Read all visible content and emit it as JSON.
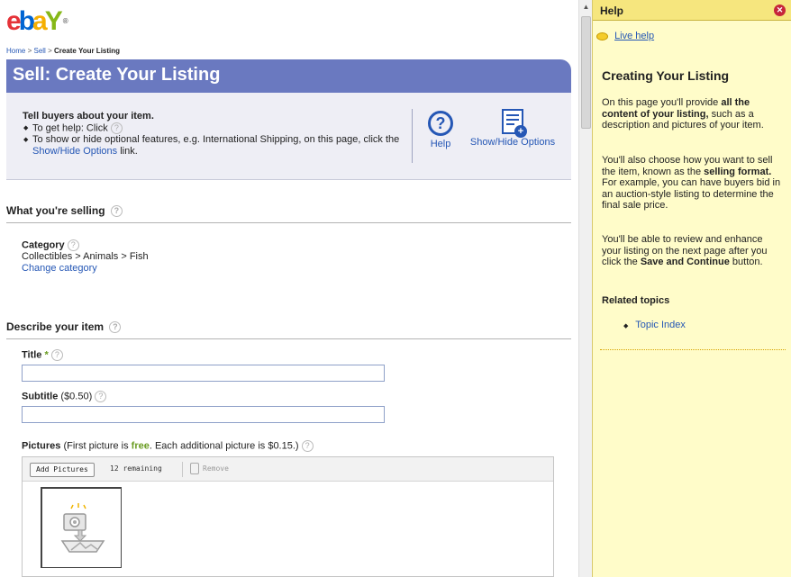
{
  "logo": {
    "e": "e",
    "b": "b",
    "a": "a",
    "y": "Y",
    "reg": "®"
  },
  "breadcrumb": {
    "home": "Home",
    "sell": "Sell",
    "current": "Create Your Listing",
    "sep": ">"
  },
  "page_title": "Sell: Create Your Listing",
  "intro": {
    "heading": "Tell buyers about your item.",
    "bullet1": "To get help: Click",
    "bullet2_pre": "To show or hide optional features, e.g. International Shipping, on this page, click the",
    "bullet2_link": "Show/Hide Options",
    "bullet2_post": "link.",
    "help_label": "Help",
    "options_label": "Show/Hide Options"
  },
  "what_selling": {
    "heading": "What you're selling",
    "category_label": "Category",
    "category_path": "Collectibles > Animals > Fish",
    "change_link": "Change category"
  },
  "describe": {
    "heading": "Describe your item",
    "title_label": "Title",
    "title_required": "*",
    "title_value": "",
    "subtitle_label": "Subtitle",
    "subtitle_price": "($0.50)",
    "subtitle_value": "",
    "pictures_label": "Pictures",
    "pictures_pre": "(First picture is",
    "pictures_free": "free",
    "pictures_post": ". Each additional picture is $0.15.)",
    "add_pictures": "Add Pictures",
    "remaining": "12 remaining",
    "remove": "Remove"
  },
  "help_panel": {
    "title": "Help",
    "live_help": "Live help",
    "heading": "Creating Your Listing",
    "p1_pre": "On this page you'll provide",
    "p1_bold": "all the content of your listing,",
    "p1_post": "such as a description and pictures of your item.",
    "p2_pre": "You'll also choose how you want to sell the item, known as the",
    "p2_bold": "selling format.",
    "p2_post": "For example, you can have buyers bid in an auction-style listing to determine the final sale price.",
    "p3_pre": "You'll be able to review and enhance your listing on the next page after you click the",
    "p3_bold": "Save and Continue",
    "p3_post": "button.",
    "related": "Related topics",
    "topic": "Topic Index"
  },
  "icons": [
    "help-circle-icon",
    "show-hide-options-icon",
    "question-icon",
    "trash-icon",
    "picture-placeholder-icon",
    "close-icon",
    "eye-icon",
    "bullet-icon"
  ],
  "colors": {
    "title_bar": "#6a79c0",
    "intro_bg": "#eeeef5",
    "help_bg": "#fffcc9",
    "help_header": "#f6e67e",
    "link": "#2557b5",
    "required": "#6a9c22"
  }
}
